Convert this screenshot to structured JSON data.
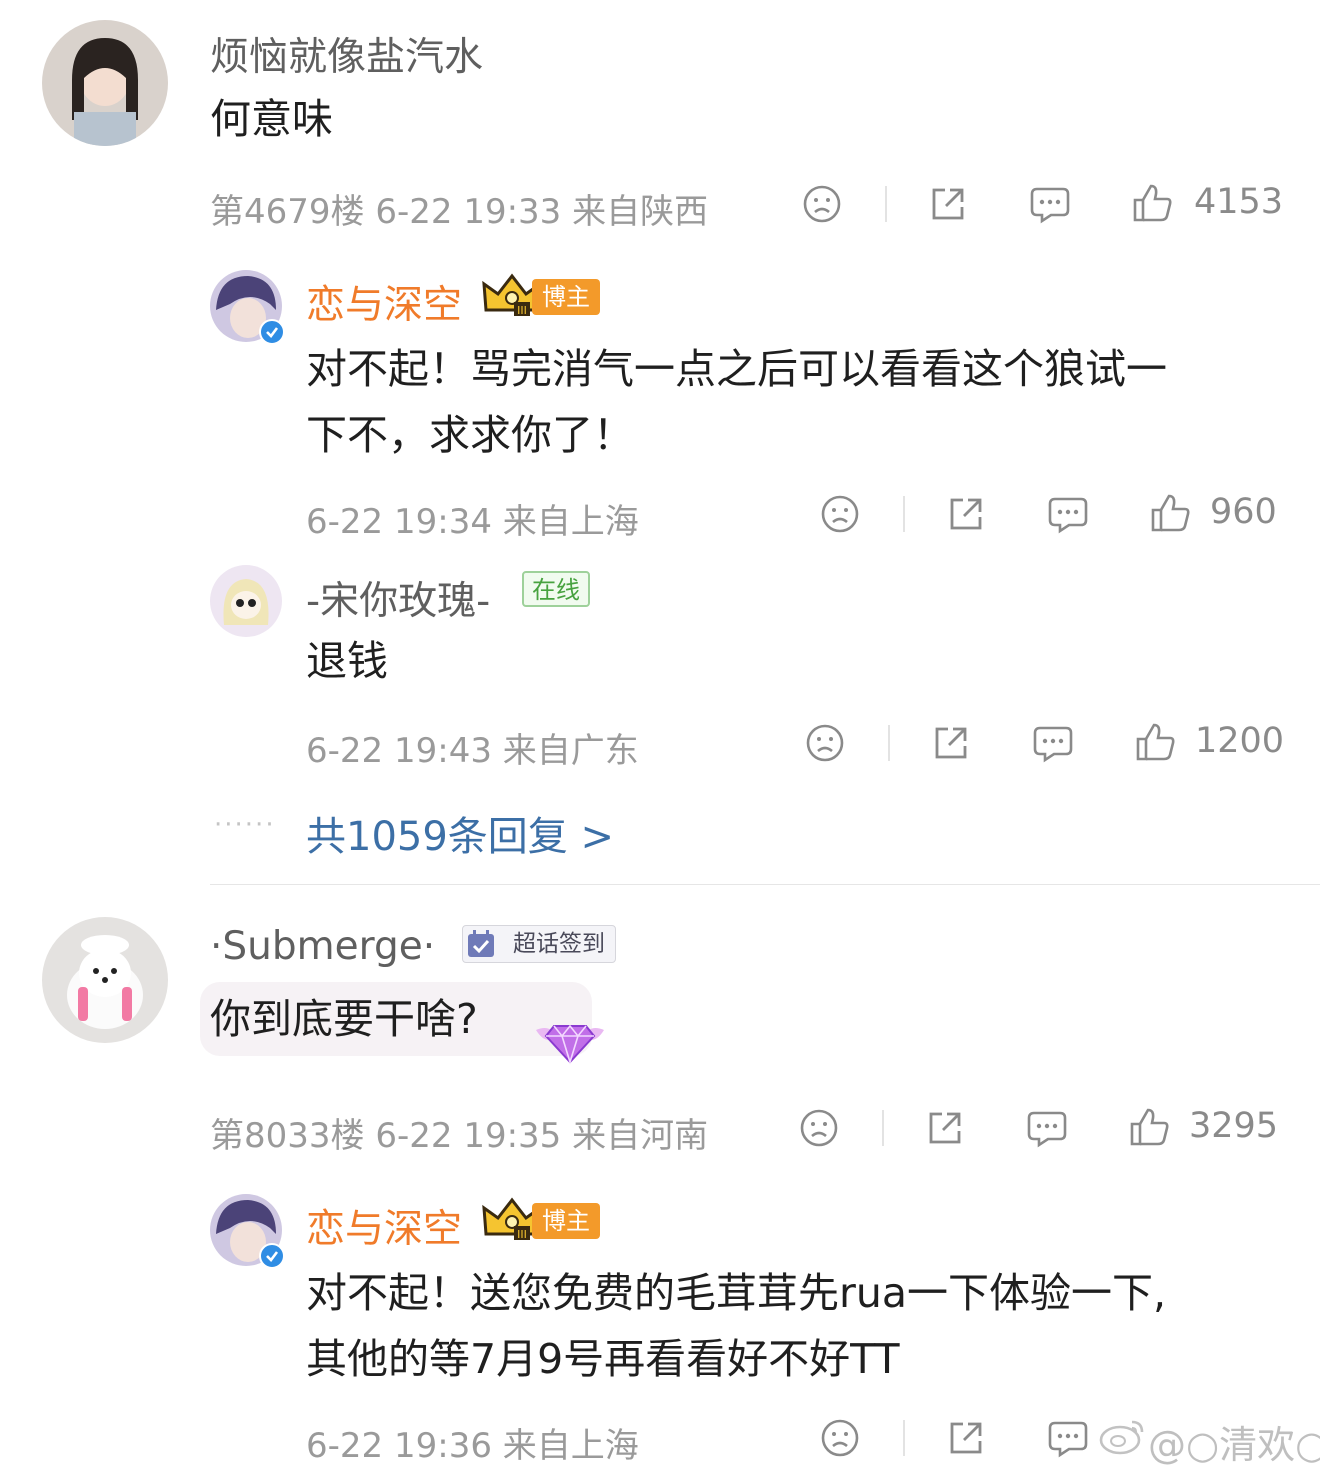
{
  "comments": [
    {
      "user": "烦恼就像盐汽水",
      "text": "何意味",
      "floor": "第4679楼",
      "time": "6-22 19:33",
      "location": "来自陕西",
      "likes": "4153",
      "icons": [
        "sad-face-icon",
        "share-icon",
        "comment-icon",
        "thumbs-up-icon"
      ],
      "replies": [
        {
          "user": "恋与深空",
          "badge": "博主",
          "text_line1": "对不起！骂完消气一点之后可以看看这个狼试一",
          "text_line2": "下不，求求你了！",
          "time": "6-22 19:34",
          "location": "来自上海",
          "likes": "960"
        },
        {
          "user": "-宋你玫瑰-",
          "badge": "在线",
          "text": "退钱",
          "time": "6-22 19:43",
          "location": "来自广东",
          "likes": "1200"
        }
      ],
      "more_replies": "共1059条回复 >",
      "dots": "······"
    },
    {
      "user": "·Submerge·",
      "badge": "超话签到",
      "text": "你到底要干啥?",
      "floor": "第8033楼",
      "time": "6-22 19:35",
      "location": "来自河南",
      "likes": "3295",
      "replies": [
        {
          "user": "恋与深空",
          "badge": "博主",
          "text_line1": "对不起！送您免费的毛茸茸先rua一下体验一下,",
          "text_line2": "其他的等7月9号再看看好不好TT",
          "time": "6-22 19:36",
          "location": "来自上海",
          "likes": ""
        }
      ]
    }
  ],
  "watermark": "@○清欢○",
  "colors": {
    "host_orange": "#f07b2a",
    "link_blue": "#3c6fa6",
    "meta_gray": "#9a9a9a",
    "online_green": "#47a23f"
  }
}
